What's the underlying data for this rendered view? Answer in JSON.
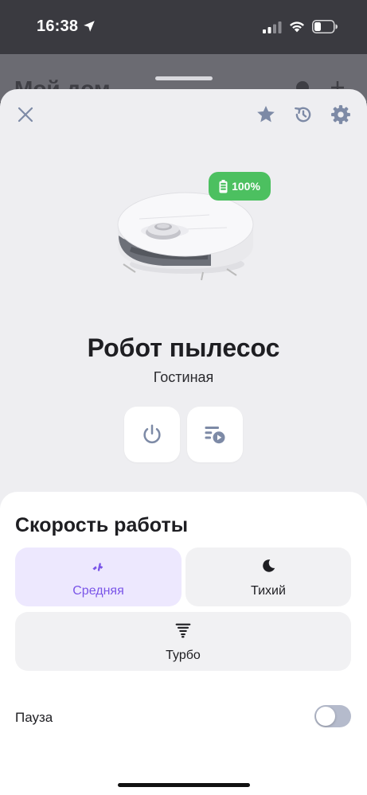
{
  "status_bar": {
    "time": "16:38"
  },
  "background_page": {
    "title": "Мой дом"
  },
  "device": {
    "name": "Робот пылесос",
    "room": "Гостиная",
    "battery": "100%",
    "battery_level": 1.0
  },
  "icons": {
    "close": "close-icon",
    "favorite": "star-icon",
    "history": "history-icon",
    "settings": "gear-icon",
    "power": "power-icon",
    "scenarios": "playlist-play-icon",
    "medium": "gauge-icon",
    "quiet": "moon-icon",
    "turbo": "tornado-icon"
  },
  "speed": {
    "title": "Скорость работы",
    "modes": [
      {
        "label": "Средняя",
        "selected": true
      },
      {
        "label": "Тихий",
        "selected": false
      },
      {
        "label": "Турбо",
        "selected": false
      }
    ]
  },
  "pause": {
    "label": "Пауза",
    "enabled": false
  },
  "colors": {
    "accent": "#7a55e8",
    "battery_badge": "#4cc060",
    "icon_gray": "#7d8aa6",
    "toggle_off": "#b5bbcc"
  }
}
